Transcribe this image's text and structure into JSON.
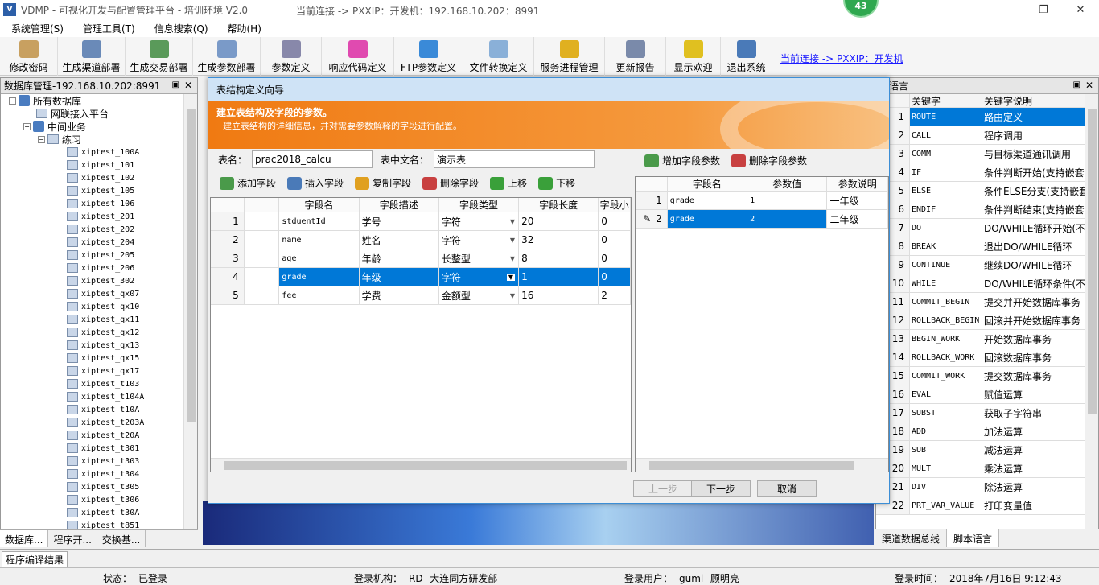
{
  "title_bar": {
    "app_title": "VDMP - 可视化开发与配置管理平台 - 培训环境 V2.0",
    "connection": "当前连接 -> PXXIP：开发机：192.168.10.202：8991",
    "badge": "43",
    "min": "—",
    "max": "❐",
    "close": "✕"
  },
  "menu": [
    "系统管理(S)",
    "管理工具(T)",
    "信息搜索(Q)",
    "帮助(H)"
  ],
  "toolbar": {
    "buttons": [
      {
        "label": "修改密码",
        "color": "#c8a060"
      },
      {
        "label": "生成渠道部署",
        "color": "#6a8ab8"
      },
      {
        "label": "生成交易部署",
        "color": "#5a9a5a"
      },
      {
        "label": "生成参数部署",
        "color": "#7a9ac8"
      },
      {
        "label": "参数定义",
        "color": "#8888aa"
      },
      {
        "label": "响应代码定义",
        "color": "#e04ab0"
      },
      {
        "label": "FTP参数定义",
        "color": "#3a8ad8"
      },
      {
        "label": "文件转换定义",
        "color": "#8ab0d8"
      },
      {
        "label": "服务进程管理",
        "color": "#e0b020"
      },
      {
        "label": "更新报告",
        "color": "#7a8aaa"
      },
      {
        "label": "显示欢迎",
        "color": "#e0c020"
      },
      {
        "label": "退出系统",
        "color": "#4a7ab8"
      }
    ],
    "connection_link": "当前连接 -> PXXIP：开发机"
  },
  "left_panel": {
    "title": "数据库管理-192.168.10.202:8991",
    "root": "所有数据库",
    "node1": "网联接入平台",
    "node2": "中间业务",
    "node3": "练习",
    "items": [
      "xiptest_100A",
      "xiptest_101",
      "xiptest_102",
      "xiptest_105",
      "xiptest_106",
      "xiptest_201",
      "xiptest_202",
      "xiptest_204",
      "xiptest_205",
      "xiptest_206",
      "xiptest_302",
      "xiptest_qx07",
      "xiptest_qx10",
      "xiptest_qx11",
      "xiptest_qx12",
      "xiptest_qx13",
      "xiptest_qx15",
      "xiptest_qx17",
      "xiptest_t103",
      "xiptest_t104A",
      "xiptest_t10A",
      "xiptest_t203A",
      "xiptest_t20A",
      "xiptest_t301",
      "xiptest_t303",
      "xiptest_t304",
      "xiptest_t305",
      "xiptest_t306",
      "xiptest_t30A",
      "xiptest_t851"
    ],
    "tabs": [
      "数据库...",
      "程序开...",
      "交换基..."
    ]
  },
  "right_panel": {
    "title": "本语言",
    "col_keyword": "关键字",
    "col_desc": "关键字说明",
    "rows": [
      {
        "n": "1",
        "k": "ROUTE",
        "d": "路由定义"
      },
      {
        "n": "2",
        "k": "CALL",
        "d": "程序调用"
      },
      {
        "n": "3",
        "k": "COMM",
        "d": "与目标渠道通讯调用"
      },
      {
        "n": "4",
        "k": "IF",
        "d": "条件判断开始(支持嵌套"
      },
      {
        "n": "5",
        "k": "ELSE",
        "d": "条件ELSE分支(支持嵌套"
      },
      {
        "n": "6",
        "k": "ENDIF",
        "d": "条件判断结束(支持嵌套"
      },
      {
        "n": "7",
        "k": "DO",
        "d": "DO/WHILE循环开始(不支"
      },
      {
        "n": "8",
        "k": "BREAK",
        "d": "退出DO/WHILE循环"
      },
      {
        "n": "9",
        "k": "CONTINUE",
        "d": "继续DO/WHILE循环"
      },
      {
        "n": "10",
        "k": "WHILE",
        "d": "DO/WHILE循环条件(不支"
      },
      {
        "n": "11",
        "k": "COMMIT_BEGIN",
        "d": "提交并开始数据库事务"
      },
      {
        "n": "12",
        "k": "ROLLBACK_BEGIN",
        "d": "回滚并开始数据库事务"
      },
      {
        "n": "13",
        "k": "BEGIN_WORK",
        "d": "开始数据库事务"
      },
      {
        "n": "14",
        "k": "ROLLBACK_WORK",
        "d": "回滚数据库事务"
      },
      {
        "n": "15",
        "k": "COMMIT_WORK",
        "d": "提交数据库事务"
      },
      {
        "n": "16",
        "k": "EVAL",
        "d": "赋值运算"
      },
      {
        "n": "17",
        "k": "SUBST",
        "d": "获取子字符串"
      },
      {
        "n": "18",
        "k": "ADD",
        "d": "加法运算"
      },
      {
        "n": "19",
        "k": "SUB",
        "d": "减法运算"
      },
      {
        "n": "20",
        "k": "MULT",
        "d": "乘法运算"
      },
      {
        "n": "21",
        "k": "DIV",
        "d": "除法运算"
      },
      {
        "n": "22",
        "k": "PRT_VAR_VALUE",
        "d": "打印变量值"
      }
    ],
    "tabs": [
      "渠道数据总线",
      "脚本语言"
    ]
  },
  "dialog": {
    "title": "表结构定义向导",
    "banner_title": "建立表结构及字段的参数。",
    "banner_sub": "建立表结构的详细信息，并对需要参数解释的字段进行配置。",
    "table_name_label": "表名：",
    "table_name_value": "prac2018_calcu",
    "table_cn_label": "表中文名：",
    "table_cn_value": "演示表",
    "field_buttons": [
      {
        "label": "添加字段",
        "color": "#4a9a4a"
      },
      {
        "label": "插入字段",
        "color": "#4a7ab8"
      },
      {
        "label": "复制字段",
        "color": "#e0a020"
      },
      {
        "label": "删除字段",
        "color": "#c84040"
      },
      {
        "label": "上移",
        "color": "#3aa03a"
      },
      {
        "label": "下移",
        "color": "#3aa03a"
      }
    ],
    "param_buttons": [
      {
        "label": "增加字段参数",
        "color": "#4a9a4a"
      },
      {
        "label": "删除字段参数",
        "color": "#c84040"
      }
    ],
    "fields_headers": [
      "字段名",
      "字段描述",
      "字段类型",
      "字段长度",
      "字段小"
    ],
    "fields": [
      {
        "n": "1",
        "name": "stduentId",
        "desc": "学号",
        "type": "字符",
        "len": "20",
        "dec": "0"
      },
      {
        "n": "2",
        "name": "name",
        "desc": "姓名",
        "type": "字符",
        "len": "32",
        "dec": "0"
      },
      {
        "n": "3",
        "name": "age",
        "desc": "年龄",
        "type": "长整型",
        "len": "8",
        "dec": "0"
      },
      {
        "n": "4",
        "name": "grade",
        "desc": "年级",
        "type": "字符",
        "len": "1",
        "dec": "0"
      },
      {
        "n": "5",
        "name": "fee",
        "desc": "学费",
        "type": "金额型",
        "len": "16",
        "dec": "2"
      }
    ],
    "params_headers": [
      "字段名",
      "参数值",
      "参数说明"
    ],
    "params": [
      {
        "n": "1",
        "name": "grade",
        "value": "1",
        "desc": "一年级"
      },
      {
        "n": "2",
        "name": "grade",
        "value": "2",
        "desc": "二年级"
      }
    ],
    "btn_prev": "上一步",
    "btn_next": "下一步",
    "btn_cancel": "取消"
  },
  "compile_tab": "程序编译结果",
  "status": {
    "state_label": "状态：",
    "state_value": "已登录",
    "org_label": "登录机构：",
    "org_value": "RD--大连同方研发部",
    "user_label": "登录用户：",
    "user_value": "guml--顾明亮",
    "time_label": "登录时间：",
    "time_value": "2018年7月16日   9:12:43"
  }
}
